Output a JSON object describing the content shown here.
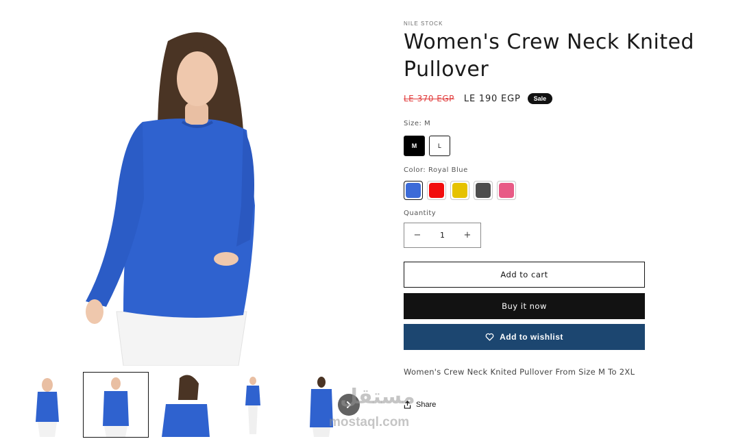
{
  "product": {
    "vendor": "NILE STOCK",
    "title": "Women's Crew Neck Knited Pullover",
    "price_old": "LE 370 EGP",
    "price_new": "LE 190 EGP",
    "badge": "Sale",
    "size_label": "Size: M",
    "sizes": [
      "M",
      "L"
    ],
    "selected_size": "M",
    "color_label": "Color: Royal Blue",
    "colors": [
      {
        "name": "Royal Blue",
        "hex": "#3c6bd8"
      },
      {
        "name": "Red",
        "hex": "#f20d0d"
      },
      {
        "name": "Yellow",
        "hex": "#e6c200"
      },
      {
        "name": "Gray",
        "hex": "#4d4d4d"
      },
      {
        "name": "Pink",
        "hex": "#e85b86"
      }
    ],
    "quantity_label": "Quantity",
    "quantity_value": "1",
    "qty_minus": "−",
    "qty_plus": "+",
    "description": "Women's Crew Neck Knited Pullover From Size M To 2XL"
  },
  "actions": {
    "add_to_cart": "Add to cart",
    "buy_now": "Buy it now",
    "add_to_wishlist": "Add to wishlist",
    "share": "Share"
  },
  "gallery": {
    "thumbnail_count": 5,
    "selected_index": 1,
    "next_icon": "chevron-right-icon"
  },
  "watermark": {
    "arabic": "مستقل",
    "latin": "mostaql.com"
  },
  "colors": {
    "sweater": "#2f62cf",
    "wishlist_button": "#1c4670",
    "sale_red": "#e13a3a"
  }
}
